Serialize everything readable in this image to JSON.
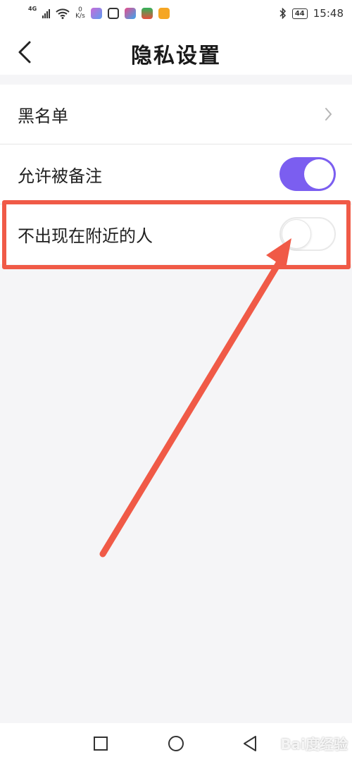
{
  "status_bar": {
    "network": "4G",
    "speed_value": "0",
    "speed_unit": "K/s",
    "battery": "44",
    "time": "15:48",
    "icons": [
      "signal-icon",
      "wifi-icon",
      "app-icon",
      "app-icon",
      "app-icon",
      "app-icon",
      "app-icon",
      "bluetooth-icon",
      "battery-icon"
    ]
  },
  "header": {
    "title": "隐私设置",
    "back_icon": "chevron-left-icon"
  },
  "settings": {
    "items": [
      {
        "label": "黑名单",
        "control": "chevron-right-icon"
      },
      {
        "label": "允许被备注",
        "control": "toggle",
        "checked": true
      },
      {
        "label": "不出现在附近的人",
        "control": "toggle",
        "checked": false
      }
    ]
  },
  "colors": {
    "accent": "#7b5ef0",
    "annotation": "#f05a47",
    "background": "#f5f5f7"
  },
  "nav_bar": {
    "icons": [
      "recent-apps-icon",
      "home-icon",
      "back-triangle-icon"
    ]
  },
  "watermark": {
    "text": "Bai度经验"
  }
}
